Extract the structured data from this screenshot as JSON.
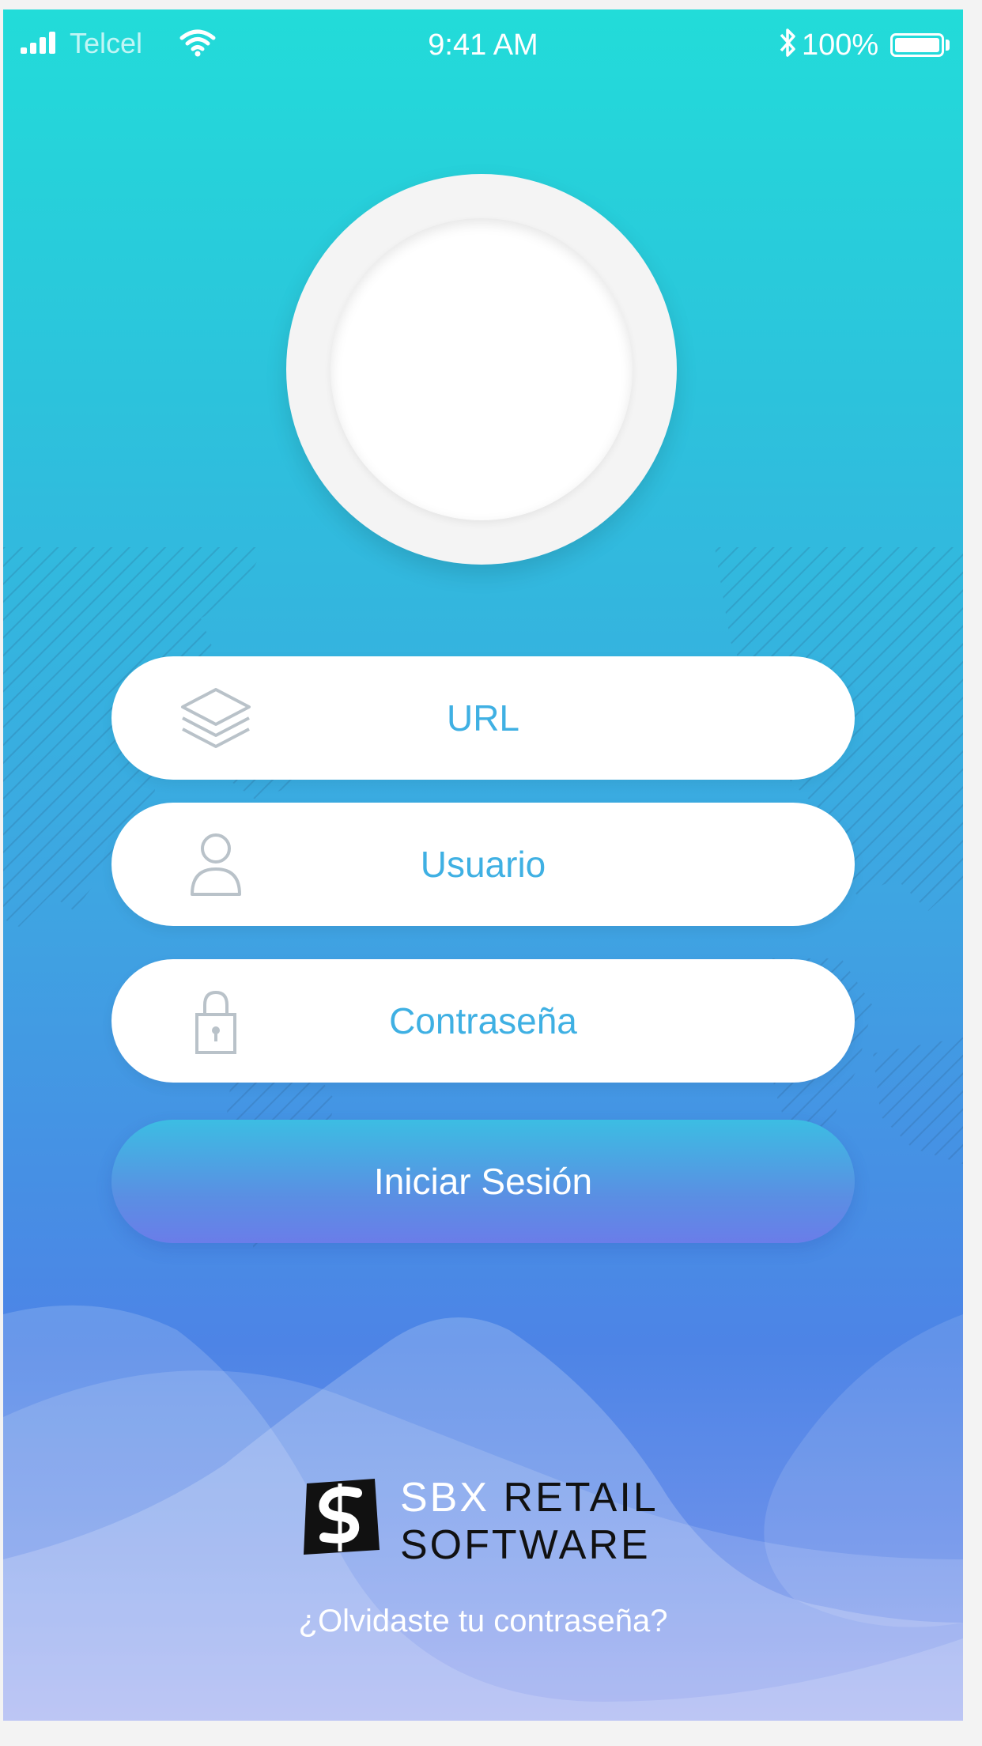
{
  "status_bar": {
    "carrier": "Telcel",
    "time": "9:41 AM",
    "battery_percent": "100%",
    "icons": [
      "signal-icon",
      "wifi-icon",
      "bluetooth-icon",
      "battery-icon"
    ]
  },
  "avatar": {
    "icon": "profile-avatar-placeholder"
  },
  "form": {
    "url_field": {
      "label": "URL",
      "icon": "layers-icon"
    },
    "user_field": {
      "label": "Usuario",
      "icon": "user-icon"
    },
    "password_field": {
      "label": "Contraseña",
      "icon": "lock-icon"
    },
    "login_button": {
      "label": "Iniciar Sesión"
    }
  },
  "brand": {
    "word1": "SBX",
    "word2": "RETAIL",
    "word3": "SOFTWARE",
    "icon": "sbx-logo-mark"
  },
  "forgot_password": "¿Olvidaste tu contraseña?",
  "colors": {
    "gradient_top": "#22dcd9",
    "gradient_bottom": "#8e9eee",
    "field_text": "#3fb0e3",
    "icon_grey": "#b9c2c9"
  }
}
